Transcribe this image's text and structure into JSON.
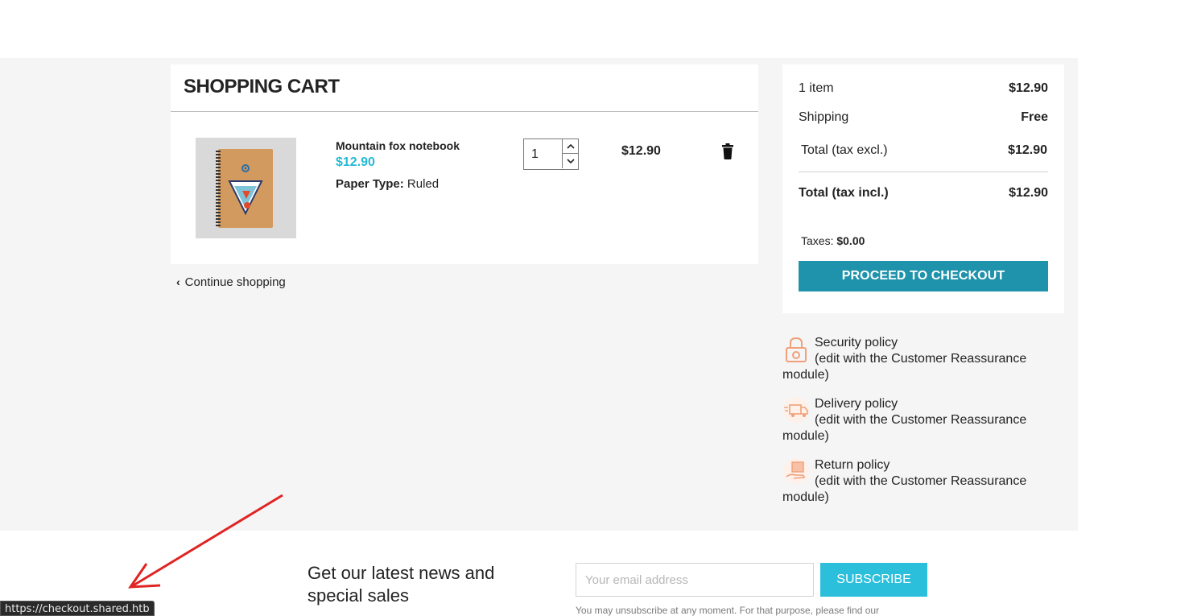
{
  "cart": {
    "title": "SHOPPING CART",
    "item": {
      "name": "Mountain fox notebook",
      "price": "$12.90",
      "attribute_key": "Paper Type:",
      "attribute_value": "Ruled",
      "quantity": "1",
      "total": "$12.90",
      "image_icon": "notebook-product-image"
    },
    "continue_label": "Continue shopping"
  },
  "summary": {
    "items_label": "1 item",
    "items_value": "$12.90",
    "shipping_label": "Shipping",
    "shipping_value": "Free",
    "total_excl_label": "Total (tax excl.)",
    "total_excl_value": "$12.90",
    "total_incl_label": "Total (tax incl.)",
    "total_incl_value": "$12.90",
    "taxes_label": "Taxes:",
    "taxes_value": "$0.00",
    "checkout_label": "PROCEED TO CHECKOUT"
  },
  "reassurance": [
    {
      "title": "Security policy",
      "desc": "(edit with the Customer Reassurance module)",
      "icon": "lock-icon"
    },
    {
      "title": "Delivery policy",
      "desc": "(edit with the Customer Reassurance module)",
      "icon": "truck-icon"
    },
    {
      "title": "Return policy",
      "desc": "(edit with the Customer Reassurance module)",
      "icon": "return-box-icon"
    }
  ],
  "newsletter": {
    "title": "Get our latest news and special sales",
    "email_placeholder": "Your email address",
    "subscribe_label": "SUBSCRIBE",
    "note": "You may unsubscribe at any moment. For that purpose, please find our"
  },
  "status_bar": {
    "url": "https://checkout.shared.htb"
  },
  "colors": {
    "accent_price": "#24b9d7",
    "checkout_button": "#1e93ab",
    "subscribe_button": "#2cbfdc",
    "annotation_arrow": "#e02424",
    "reassurance_icon": "#f0a07a"
  }
}
